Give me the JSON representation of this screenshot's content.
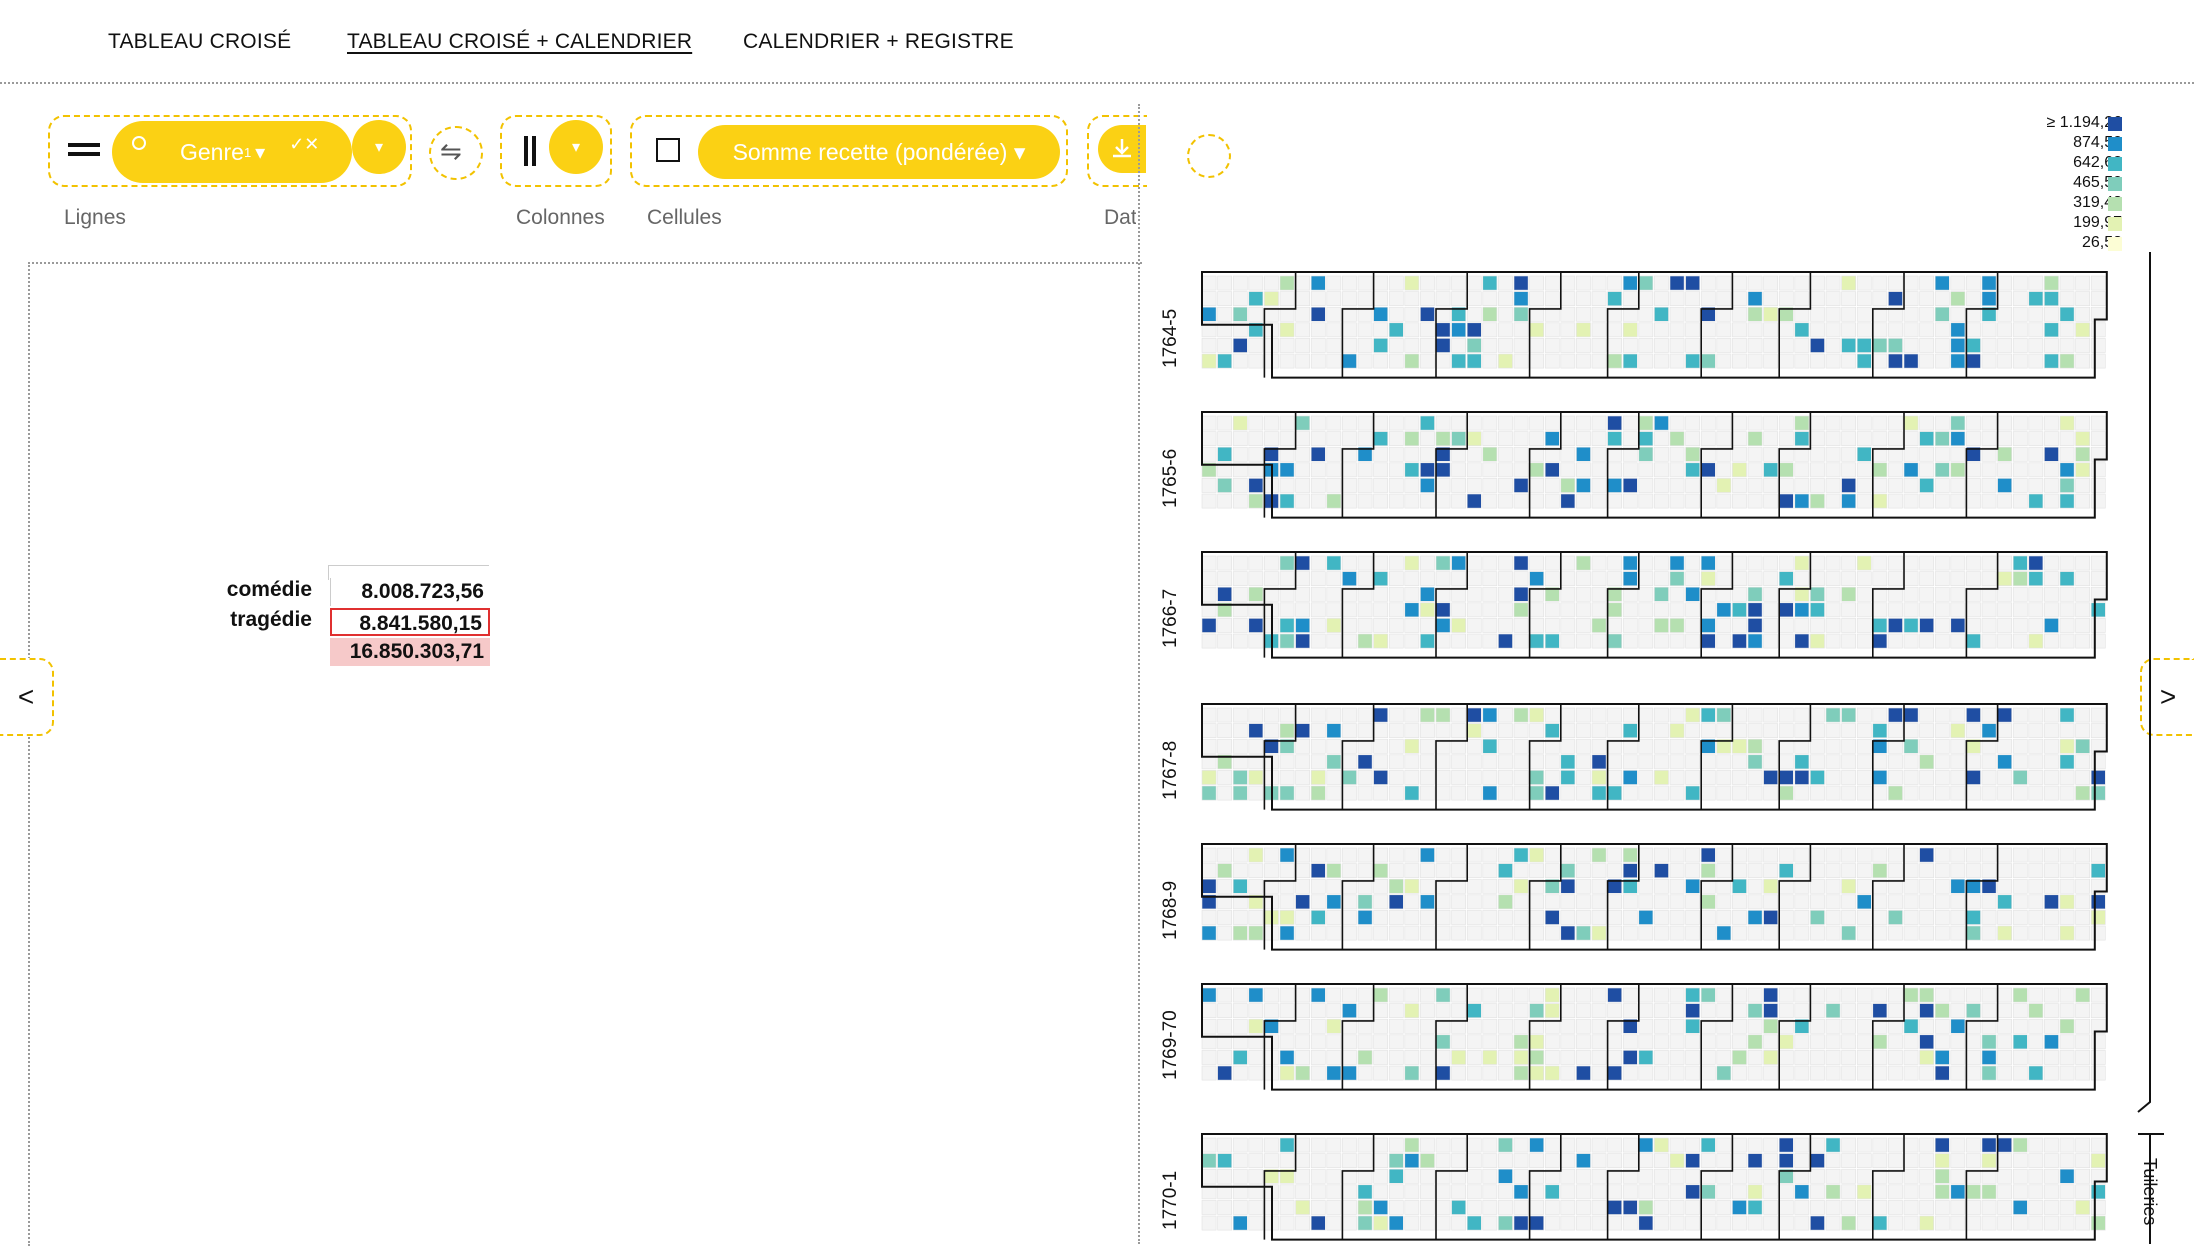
{
  "tabs": [
    "TABLEAU CROISÉ",
    "TABLEAU CROISÉ + CALENDRIER",
    "CALENDRIER + REGISTRE"
  ],
  "active_tab": 1,
  "controls": {
    "rows_pill": "Genre",
    "rows_pill_sub": "1",
    "rows_pill_arrow": "▾",
    "rows_pill_actions": "✓✕",
    "rows_label": "Lignes",
    "swap_icon": "⇋",
    "columns_label": "Colonnes",
    "cells_label": "Cellules",
    "cells_pill": "Somme recette (pondérée) ▾",
    "download_label": "Dat",
    "dropdown_glyph": "▾"
  },
  "pivot": {
    "rows": [
      {
        "label": "comédie",
        "value": "8.008.723,56"
      },
      {
        "label": "tragédie",
        "value": "8.841.580,15"
      }
    ],
    "total": "16.850.303,71"
  },
  "nav": {
    "prev": "<",
    "next": ">"
  },
  "legend": {
    "labels": [
      "≥ 1.194,26",
      "874,50",
      "642,62",
      "465,50",
      "319,48",
      "199,97",
      "26,58"
    ],
    "colors": [
      "#1f4ea3",
      "#1f8ec9",
      "#41b6c4",
      "#7fcdbb",
      "#b5e0b0",
      "#e3f2b3",
      "#fcfdd5"
    ]
  },
  "seasons": [
    "1764-5",
    "1765-6",
    "1766-7",
    "1767-8",
    "1768-9",
    "1769-70",
    "1770-1"
  ],
  "venue_label": "Tuileries"
}
